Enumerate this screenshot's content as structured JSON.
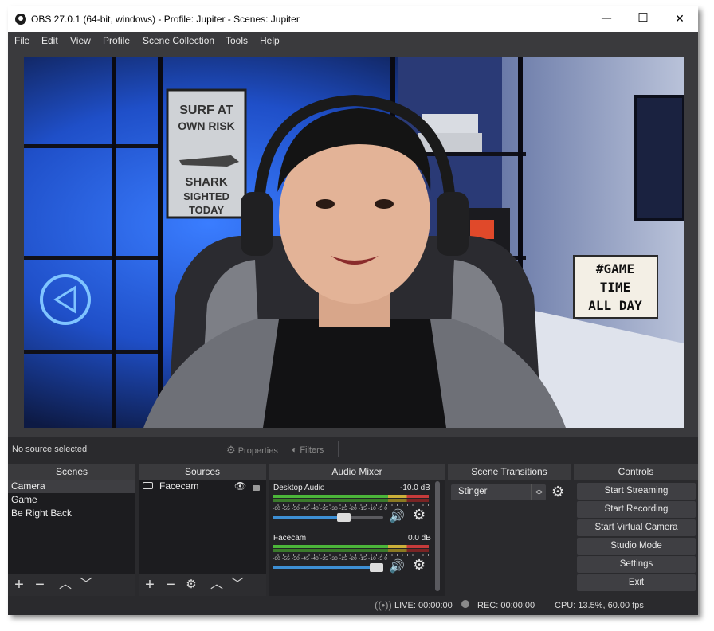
{
  "window": {
    "title": "OBS 27.0.1 (64-bit, windows) - Profile: Jupiter - Scenes: Jupiter",
    "minimize": "─",
    "maximize": "☐",
    "close": "✕"
  },
  "menu": [
    "File",
    "Edit",
    "View",
    "Profile",
    "Scene Collection",
    "Tools",
    "Help"
  ],
  "preview": {
    "poster_lines": [
      "SURF AT",
      "OWN RISK",
      "SHARK",
      "SIGHTED",
      "TODAY"
    ],
    "lightbox_lines": [
      "#GAME",
      "TIME",
      "ALL DAY"
    ]
  },
  "source_toolbar": {
    "status": "No source selected",
    "properties": "Properties",
    "filters": "Filters"
  },
  "scenes": {
    "header": "Scenes",
    "items": [
      "Camera",
      "Game",
      "Be Right Back"
    ],
    "selected_index": 0
  },
  "sources": {
    "header": "Sources",
    "items": [
      {
        "name": "Facecam",
        "visible": true,
        "locked": false
      }
    ]
  },
  "audio_mixer": {
    "header": "Audio Mixer",
    "scale_text": "-60 -55 -50 -45 -40 -35 -30 -25 -20 -15 -10 -5 0",
    "channels": [
      {
        "name": "Desktop Audio",
        "db": "-10.0 dB",
        "volume_fraction": 0.71
      },
      {
        "name": "Facecam",
        "db": "0.0 dB",
        "volume_fraction": 1.0
      }
    ]
  },
  "transitions": {
    "header": "Scene Transitions",
    "selected": "Stinger"
  },
  "controls": {
    "header": "Controls",
    "buttons": [
      "Start Streaming",
      "Start Recording",
      "Start Virtual Camera",
      "Studio Mode",
      "Settings",
      "Exit"
    ]
  },
  "status": {
    "live": "LIVE: 00:00:00",
    "rec": "REC: 00:00:00",
    "cpu": "CPU: 13.5%, 60.00 fps"
  },
  "colors": {
    "panel": "#2a2a2d",
    "list_bg": "#1c1c1f",
    "header_bg": "#3a3a3d",
    "slider_blue": "#3d8fd4",
    "neon_blue": "#1e6fff"
  }
}
